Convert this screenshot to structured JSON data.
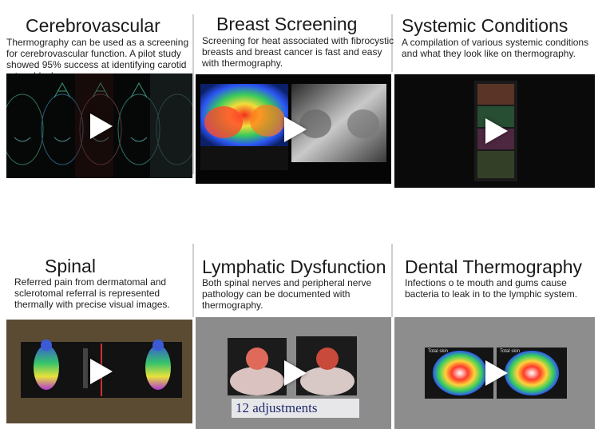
{
  "cards": [
    {
      "title": "Cerebrovascular",
      "description": "Thermography can be used as a screening for cerebrovascular function. A pilot study showed 95% success at identifying carotid artery blockages."
    },
    {
      "title": "Breast Screening",
      "description": "Screening for heat associated with fibrocystic breasts and breast cancer is fast and easy with thermography."
    },
    {
      "title": "Systemic Conditions",
      "description": "A compilation of various systemic conditions and what they look like on thermography."
    },
    {
      "title": "Spinal",
      "description": "Referred pain from dermatomal and sclerotomal referral is represented thermally with precise visual images."
    },
    {
      "title": "Lymphatic Dysfunction",
      "description": "Both spinal nerves and peripheral nerve pathology can be documented with thermography."
    },
    {
      "title": "Dental Thermography",
      "description": "Infections o te mouth and gums cause bacteria to leak in to the lymphic system."
    }
  ],
  "video_overlays": {
    "lymphatic_caption": "12 adjustments",
    "dental_label_left": "Total skin",
    "dental_label_right": "Total skin"
  }
}
